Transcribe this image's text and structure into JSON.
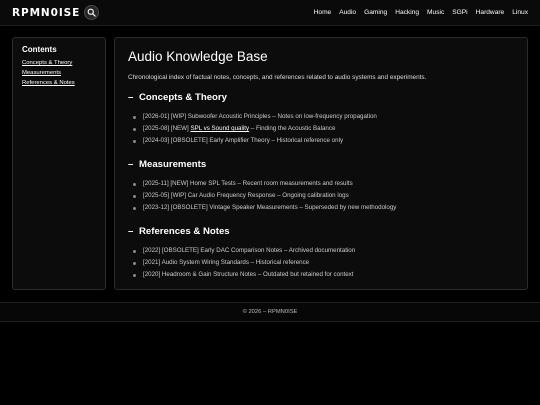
{
  "header": {
    "logo": "RPMN0ISE",
    "search_icon": "search-icon",
    "nav": [
      "Home",
      "Audio",
      "Gaming",
      "Hacking",
      "Music",
      "SGPi",
      "Hardware",
      "Linux"
    ]
  },
  "sidebar": {
    "title": "Contents",
    "links": [
      "Concepts & Theory",
      "Measurements",
      "References & Notes"
    ]
  },
  "main": {
    "title": "Audio Knowledge Base",
    "intro": "Chronological index of factual notes, concepts, and references related to audio systems and experiments.",
    "sections": [
      {
        "toggle": "–",
        "heading": "Concepts & Theory",
        "items": [
          {
            "text": "[2026-01] [WIP] Subwoofer Acoustic Principles – Notes on low-frequency propagation"
          },
          {
            "prefix": "[2025-08] [NEW] ",
            "link": "SPL vs Sound quality",
            "suffix": " – Finding the Acoustic Balance"
          },
          {
            "text": "[2024-03] [OBSOLETE] Early Amplifier Theory – Historical reference only"
          }
        ]
      },
      {
        "toggle": "–",
        "heading": "Measurements",
        "items": [
          {
            "text": "[2025-11] [NEW] Home SPL Tests – Recent room measurements and results"
          },
          {
            "text": "[2025-05] [WIP] Car Audio Frequency Response – Ongoing calibration logs"
          },
          {
            "text": "[2023-12] [OBSOLETE] Vintage Speaker Measurements – Superseded by new methodology"
          }
        ]
      },
      {
        "toggle": "–",
        "heading": "References & Notes",
        "items": [
          {
            "text": "[2022] [OBSOLETE] Early DAC Comparison Notes – Archived documentation"
          },
          {
            "text": "[2021] Audio System Wiring Standards – Historical reference"
          },
          {
            "text": "[2020] Headroom & Gain Structure Notes – Outdated but retained for context"
          }
        ]
      }
    ]
  },
  "footer": {
    "text": "© 2026 – RPMN0ISE"
  }
}
